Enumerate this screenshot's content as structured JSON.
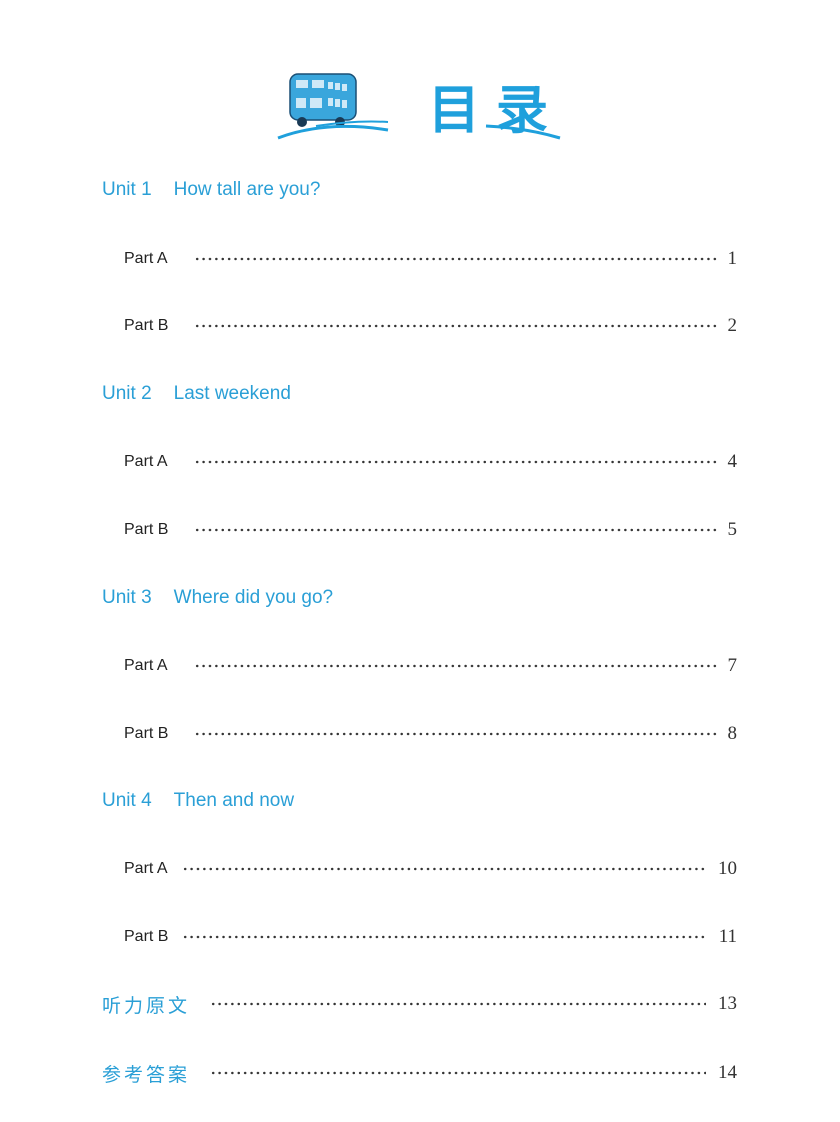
{
  "title": "目录",
  "accent_color": "#2a9fd6",
  "units": [
    {
      "label": "Unit 1",
      "title": "How tall are you?",
      "parts": [
        {
          "label": "Part A",
          "page": "1"
        },
        {
          "label": "Part B",
          "page": "2"
        }
      ]
    },
    {
      "label": "Unit 2",
      "title": "Last weekend",
      "parts": [
        {
          "label": "Part A",
          "page": "4"
        },
        {
          "label": "Part B",
          "page": "5"
        }
      ]
    },
    {
      "label": "Unit 3",
      "title": "Where did you go?",
      "parts": [
        {
          "label": "Part A",
          "page": "7"
        },
        {
          "label": "Part B",
          "page": "8"
        }
      ]
    },
    {
      "label": "Unit 4",
      "title": "Then and now",
      "parts": [
        {
          "label": "Part A",
          "page": "10"
        },
        {
          "label": "Part B",
          "page": "11"
        }
      ]
    }
  ],
  "appendix": [
    {
      "label": "听力原文",
      "page": "13"
    },
    {
      "label": "参考答案",
      "page": "14"
    }
  ]
}
